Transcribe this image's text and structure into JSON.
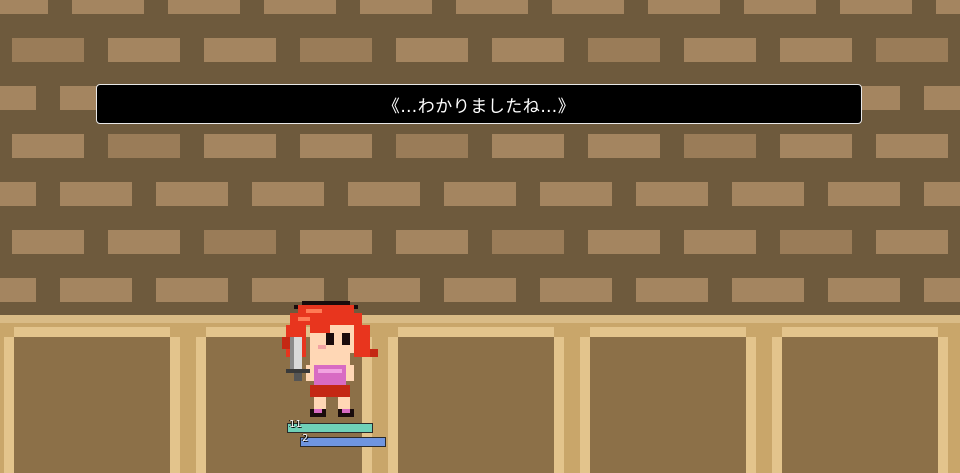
{
  "dialog": {
    "text": "《…わかりましたね…》"
  },
  "hero": {
    "name": "",
    "hp": {
      "value": "11",
      "fill_fraction": 1.0
    },
    "mp": {
      "value": "2",
      "fill_fraction": 1.0
    }
  },
  "colors": {
    "wall_mortar": "#6e5a3d",
    "wall_brick": "#a48560",
    "floor_tile": "#8c7048",
    "floor_border": "#e3c48c",
    "hp": "#6fd1b8",
    "mp": "#6f95e0",
    "hair": "#e8351e",
    "dress": "#d86bc3"
  }
}
